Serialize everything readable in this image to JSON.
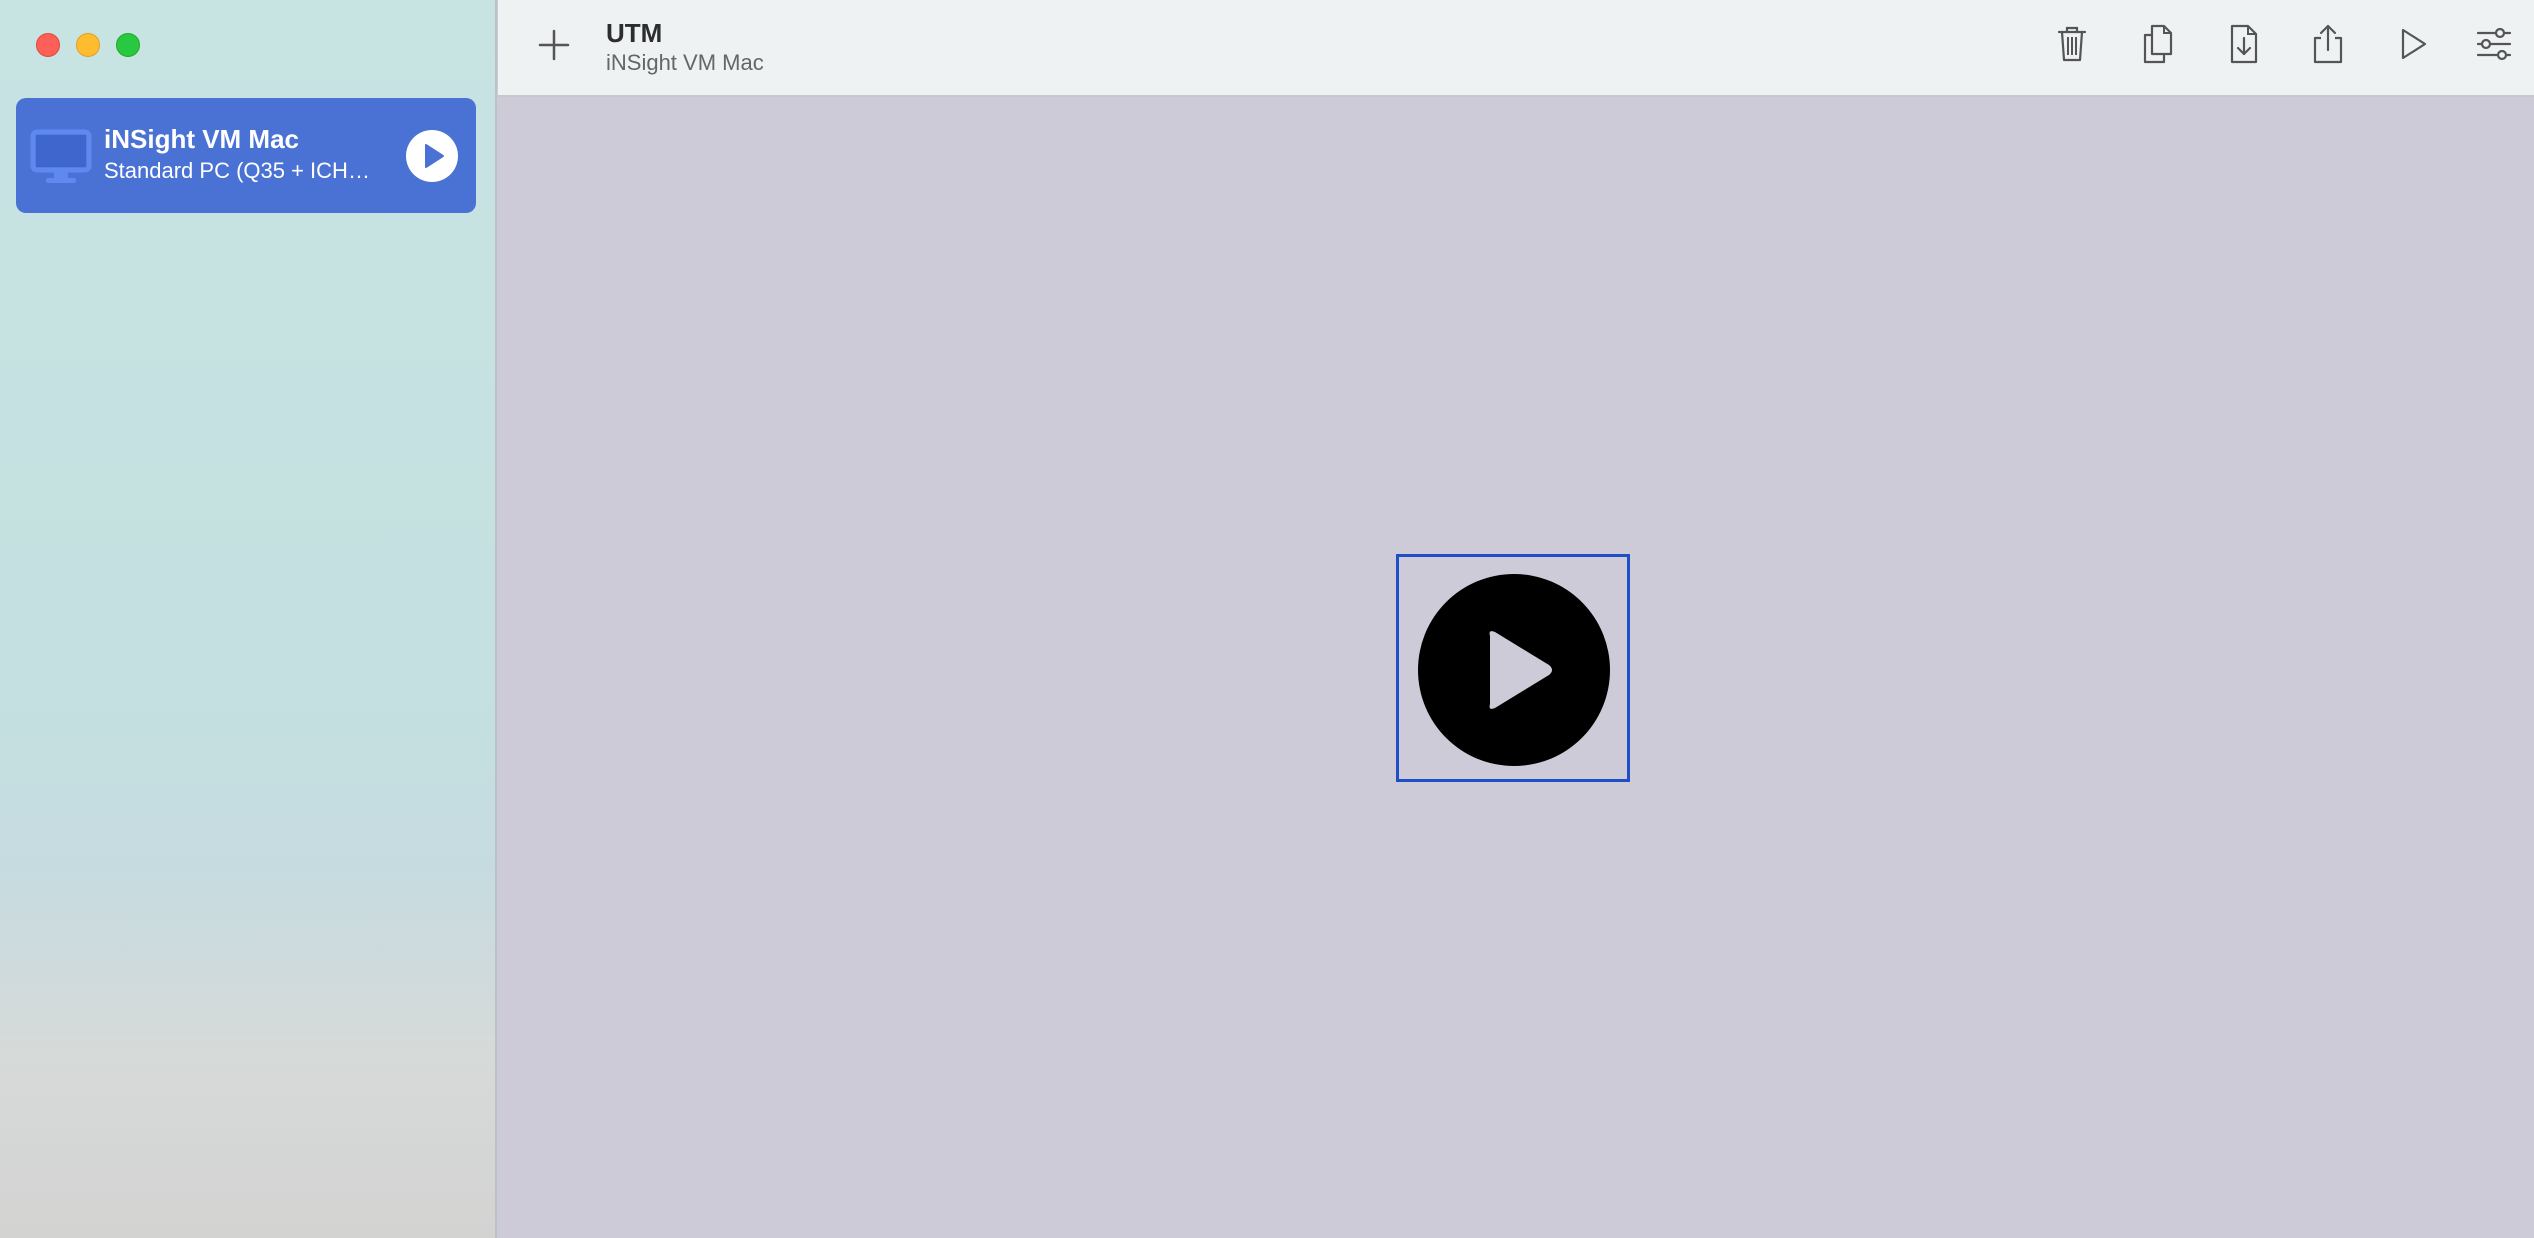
{
  "window": {
    "traffic_lights": [
      "close",
      "minimize",
      "zoom"
    ]
  },
  "sidebar": {
    "vm_list": [
      {
        "name": "iNSight VM Mac",
        "subtitle": "Standard PC (Q35 + ICH…",
        "icon": "monitor-icon",
        "selected": true
      }
    ]
  },
  "toolbar": {
    "title": "UTM",
    "subtitle": "iNSight VM Mac",
    "icons": [
      "plus-icon",
      "trash-icon",
      "clone-icon",
      "download-icon",
      "share-icon",
      "play-icon",
      "sliders-icon"
    ]
  },
  "main": {
    "center_icon": "play-circle-icon"
  },
  "colors": {
    "selection": "#4a72d4",
    "focus_ring": "#1f4fc7",
    "main_bg": "#cecbd8",
    "toolbar_bg": "#eef2f2"
  }
}
